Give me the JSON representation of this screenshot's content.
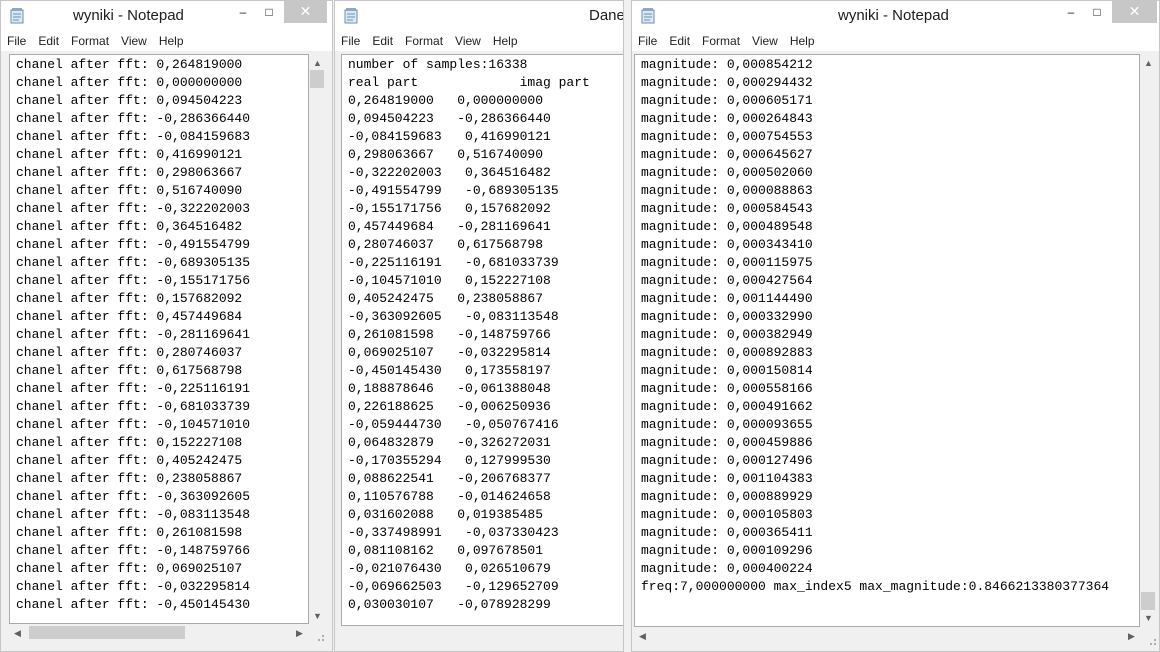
{
  "windows": [
    {
      "title": "wyniki - Notepad",
      "menu": [
        "File",
        "Edit",
        "Format",
        "View",
        "Help"
      ],
      "lines": [
        "chanel after fft: 0,264819000",
        "chanel after fft: 0,000000000",
        "chanel after fft: 0,094504223",
        "chanel after fft: -0,286366440",
        "chanel after fft: -0,084159683",
        "chanel after fft: 0,416990121",
        "chanel after fft: 0,298063667",
        "chanel after fft: 0,516740090",
        "chanel after fft: -0,322202003",
        "chanel after fft: 0,364516482",
        "chanel after fft: -0,491554799",
        "chanel after fft: -0,689305135",
        "chanel after fft: -0,155171756",
        "chanel after fft: 0,157682092",
        "chanel after fft: 0,457449684",
        "chanel after fft: -0,281169641",
        "chanel after fft: 0,280746037",
        "chanel after fft: 0,617568798",
        "chanel after fft: -0,225116191",
        "chanel after fft: -0,681033739",
        "chanel after fft: -0,104571010",
        "chanel after fft: 0,152227108",
        "chanel after fft: 0,405242475",
        "chanel after fft: 0,238058867",
        "chanel after fft: -0,363092605",
        "chanel after fft: -0,083113548",
        "chanel after fft: 0,261081598",
        "chanel after fft: -0,148759766",
        "chanel after fft: 0,069025107",
        "chanel after fft: -0,032295814",
        "chanel after fft: -0,450145430"
      ]
    },
    {
      "title": "Dane",
      "menu": [
        "File",
        "Edit",
        "Format",
        "View",
        "Help"
      ],
      "lines": [
        "number of samples:16338",
        "real part             imag part",
        "0,264819000   0,000000000",
        "0,094504223   -0,286366440",
        "-0,084159683   0,416990121",
        "0,298063667   0,516740090",
        "-0,322202003   0,364516482",
        "-0,491554799   -0,689305135",
        "-0,155171756   0,157682092",
        "0,457449684   -0,281169641",
        "0,280746037   0,617568798",
        "-0,225116191   -0,681033739",
        "-0,104571010   0,152227108",
        "0,405242475   0,238058867",
        "-0,363092605   -0,083113548",
        "0,261081598   -0,148759766",
        "0,069025107   -0,032295814",
        "-0,450145430   0,173558197",
        "0,188878646   -0,061388048",
        "0,226188625   -0,006250936",
        "-0,059444730   -0,050767416",
        "0,064832879   -0,326272031",
        "-0,170355294   0,127999530",
        "0,088622541   -0,206768377",
        "0,110576788   -0,014624658",
        "0,031602088   0,019385485",
        "-0,337498991   -0,037330423",
        "0,081108162   0,097678501",
        "-0,021076430   0,026510679",
        "-0,069662503   -0,129652709",
        "0,030030107   -0,078928299"
      ]
    },
    {
      "title": "wyniki - Notepad",
      "menu": [
        "File",
        "Edit",
        "Format",
        "View",
        "Help"
      ],
      "lines": [
        "magnitude: 0,000854212",
        "magnitude: 0,000294432",
        "magnitude: 0,000605171",
        "magnitude: 0,000264843",
        "magnitude: 0,000754553",
        "magnitude: 0,000645627",
        "magnitude: 0,000502060",
        "magnitude: 0,000088863",
        "magnitude: 0,000584543",
        "magnitude: 0,000489548",
        "magnitude: 0,000343410",
        "magnitude: 0,000115975",
        "magnitude: 0,000427564",
        "magnitude: 0,001144490",
        "magnitude: 0,000332990",
        "magnitude: 0,000382949",
        "magnitude: 0,000892883",
        "magnitude: 0,000150814",
        "magnitude: 0,000558166",
        "magnitude: 0,000491662",
        "magnitude: 0,000093655",
        "magnitude: 0,000459886",
        "magnitude: 0,000127496",
        "magnitude: 0,001104383",
        "magnitude: 0,000889929",
        "magnitude: 0,000105803",
        "magnitude: 0,000365411",
        "magnitude: 0,000109296",
        "magnitude: 0,000400224",
        "freq:7,000000000 max_index5 max_magnitude:0.8466213380377364"
      ]
    }
  ],
  "controls": {
    "minimize": "–",
    "maximize": "□",
    "close": "✕"
  },
  "scroll_glyphs": {
    "up": "▲",
    "down": "▼",
    "left": "◀",
    "right": "▶"
  },
  "colors": {
    "titlebar": "#ffffff",
    "chrome": "#f0f0f0",
    "close_inactive": "#c7c7c7",
    "scroll_thumb": "#cdcdcd"
  }
}
